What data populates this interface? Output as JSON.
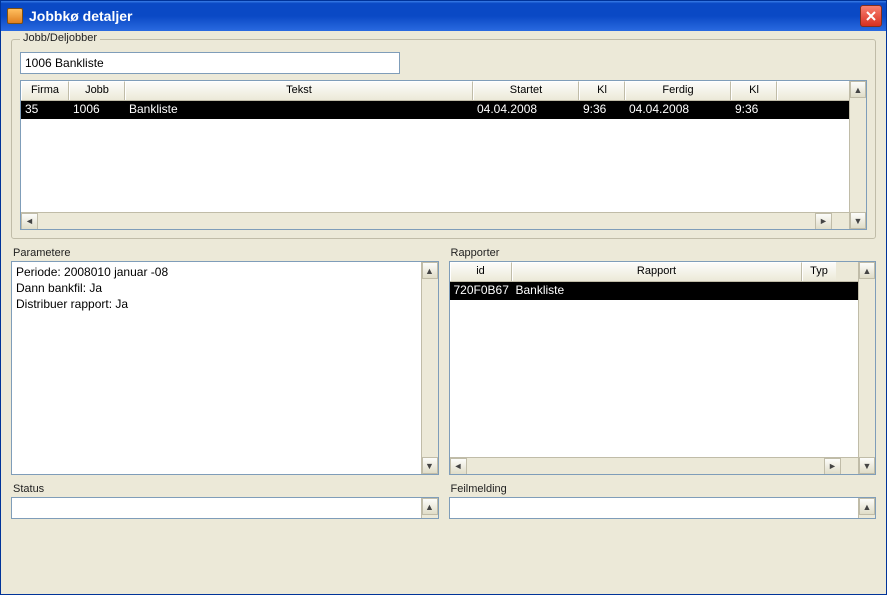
{
  "window": {
    "title": "Jobbkø detaljer"
  },
  "jobbbox": {
    "legend": "Jobb/Deljobber",
    "input_value": "1006 Bankliste",
    "columns": {
      "firma": "Firma",
      "jobb": "Jobb",
      "tekst": "Tekst",
      "startet": "Startet",
      "kl1": "Kl",
      "ferdig": "Ferdig",
      "kl2": "Kl"
    },
    "rows": [
      {
        "firma": "35",
        "jobb": "1006",
        "tekst": "Bankliste",
        "startet": "04.04.2008",
        "kl1": "9:36",
        "ferdig": "04.04.2008",
        "kl2": "9:36"
      }
    ]
  },
  "parametere": {
    "label": "Parametere",
    "text": "Periode: 2008010 januar -08\nDann bankfil: Ja\nDistribuer rapport: Ja"
  },
  "rapporter": {
    "label": "Rapporter",
    "columns": {
      "id": "id",
      "rapport": "Rapport",
      "type": "Typ"
    },
    "rows": [
      {
        "id": "720F0B67",
        "rapport": "Bankliste",
        "type": ""
      }
    ]
  },
  "status": {
    "label": "Status"
  },
  "feilmelding": {
    "label": "Feilmelding"
  }
}
